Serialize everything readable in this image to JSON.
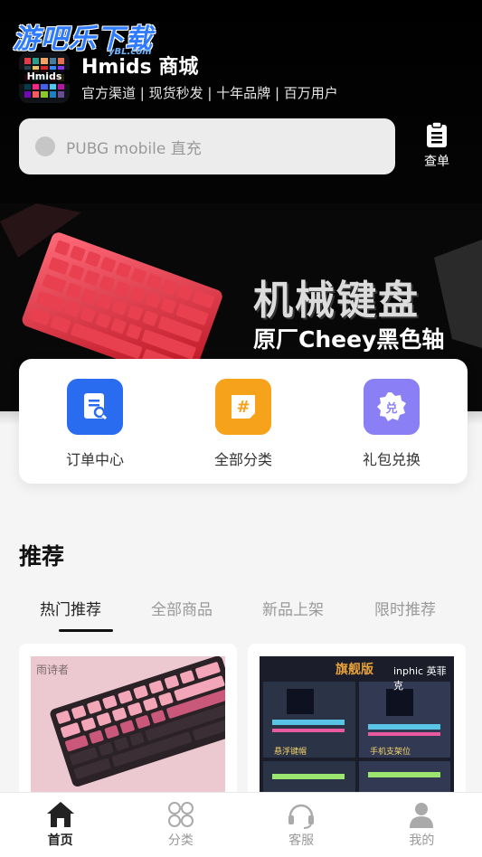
{
  "watermark": {
    "text": "游吧乐下载",
    "sub": "yBL.com"
  },
  "shop": {
    "logo_text": "Hmids",
    "name": "Hmids 商城",
    "tagline": "官方渠道 | 现货秒发 | 十年品牌 | 百万用户"
  },
  "search": {
    "placeholder": "PUBG mobile 直充"
  },
  "orders_button": {
    "label": "查单",
    "icon": "clipboard-icon"
  },
  "banner": {
    "title": "机械键盘",
    "subtitle": "原厂Cheey黑色轴"
  },
  "quick_menu": [
    {
      "label": "订单中心",
      "icon": "order-search-icon",
      "color": "#2a6cf0"
    },
    {
      "label": "全部分类",
      "icon": "hash-icon",
      "color": "#f7a21b"
    },
    {
      "label": "礼包兑换",
      "icon": "gift-badge-icon",
      "color": "#8a7ff5"
    }
  ],
  "recommend": {
    "title": "推荐",
    "tabs": [
      "热门推荐",
      "全部商品",
      "新品上架",
      "限时推荐"
    ],
    "active_tab": 0
  },
  "products": [
    {
      "brand": "雨诗者",
      "image": "pink-keyboard"
    },
    {
      "brand": "inphic 英菲克",
      "badge": "旗舰版",
      "captions": [
        "悬浮键帽",
        "手机支架位"
      ]
    }
  ],
  "bottom_nav": [
    {
      "label": "首页",
      "icon": "home-icon",
      "active": true
    },
    {
      "label": "分类",
      "icon": "grid-icon",
      "active": false
    },
    {
      "label": "客服",
      "icon": "headset-icon",
      "active": false
    },
    {
      "label": "我的",
      "icon": "user-icon",
      "active": false
    }
  ]
}
